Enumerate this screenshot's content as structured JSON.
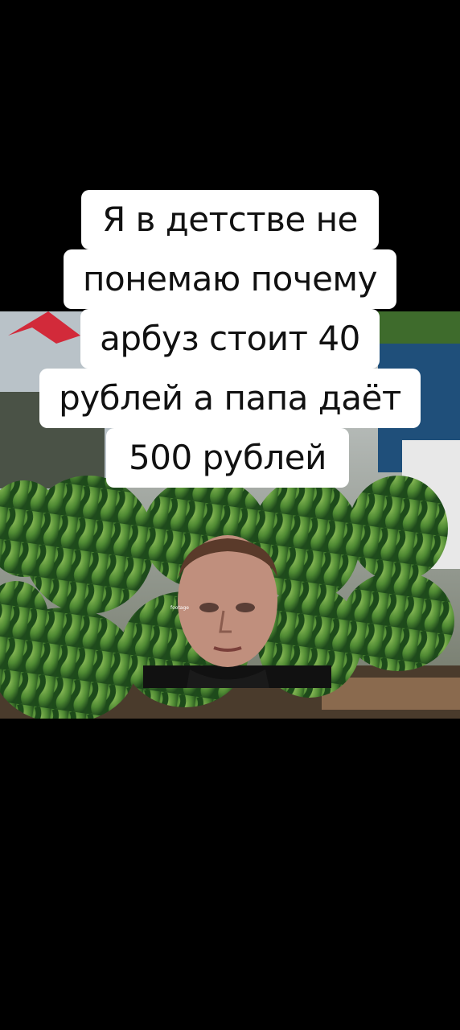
{
  "caption": {
    "lines": [
      "Я в детстве не",
      "понемаю почему",
      "арбуз стоит 40",
      "рублей а папа даёт",
      "500 рублей"
    ]
  },
  "photo": {
    "description_icon": "watermelon-photo",
    "watermark": "footage"
  },
  "colors": {
    "background": "#000000",
    "caption_bg": "#ffffff",
    "caption_text": "#111111"
  }
}
